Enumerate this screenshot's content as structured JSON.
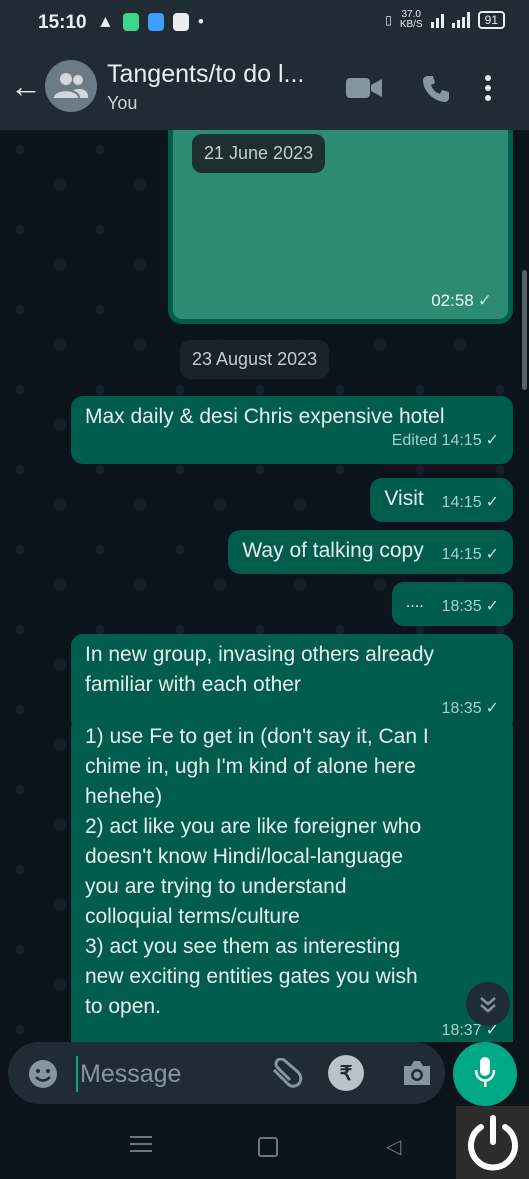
{
  "status_bar": {
    "time": "15:10",
    "net_speed_value": "37.0",
    "net_speed_unit": "KB/S",
    "battery": "91"
  },
  "header": {
    "title": "Tangents/to do l...",
    "subtitle": "You"
  },
  "chat": {
    "media": {
      "date_chip": "21 June 2023",
      "time": "02:58"
    },
    "date_separator": "23 August 2023",
    "messages": [
      {
        "text": "Max daily & desi Chris expensive hotel",
        "meta": "Edited 14:15"
      },
      {
        "text": "Visit",
        "meta": "14:15"
      },
      {
        "text": "Way of talking copy",
        "meta": "14:15"
      },
      {
        "text": "....",
        "meta": "18:35"
      },
      {
        "text": "In new group, invasing others already familiar with each other",
        "meta": "18:35"
      },
      {
        "lines": [
          "1) use Fe to get in (don't say it, Can I",
          "chime in, ugh I'm kind of alone here",
          "hehehe)",
          "2) act like you are like foreigner who",
          "doesn't know Hindi/local-language",
          "you are trying to understand",
          "colloquial terms/culture",
          "3) act you see them as interesting",
          "new exciting entities gates you wish",
          "to open."
        ],
        "meta": "18:37"
      }
    ]
  },
  "composer": {
    "placeholder": "Message"
  },
  "colors": {
    "background": "#0b141a",
    "bar": "#1f2c34",
    "outgoing_bubble": "#005c4b",
    "accent": "#00a884"
  },
  "icons": [
    "back-arrow-icon",
    "group-avatar-icon",
    "video-call-icon",
    "voice-call-icon",
    "more-options-icon",
    "emoji-icon",
    "attach-icon",
    "rupee-payment-icon",
    "camera-icon",
    "mic-icon",
    "scroll-down-icon",
    "power-icon"
  ]
}
